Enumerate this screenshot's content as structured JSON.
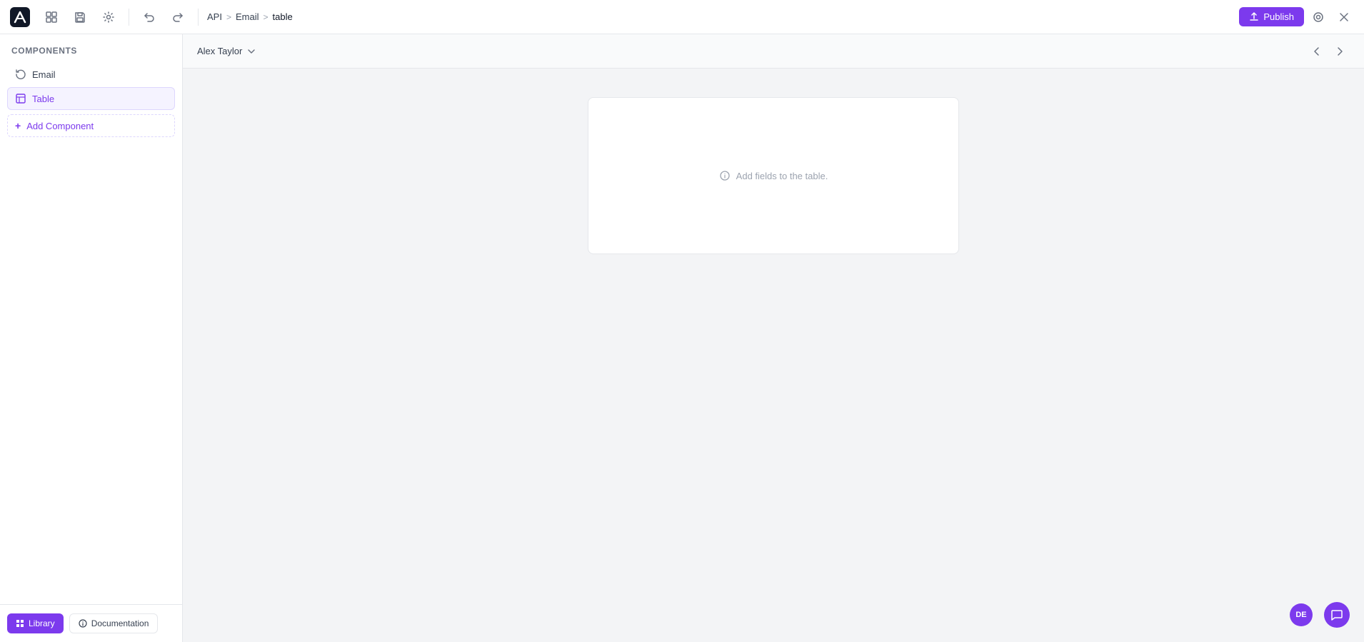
{
  "app": {
    "logo_text": "A"
  },
  "topbar": {
    "breadcrumb": {
      "api": "API",
      "sep1": ">",
      "email": "Email",
      "sep2": ">",
      "table": "table"
    },
    "undo_label": "Undo",
    "redo_label": "Redo",
    "settings_label": "Settings",
    "publish_label": "Publish",
    "preview_label": "Preview",
    "close_label": "Close"
  },
  "sidebar": {
    "title": "Components",
    "components": [
      {
        "id": "email",
        "label": "Email",
        "icon": "refresh-icon"
      },
      {
        "id": "table",
        "label": "Table",
        "icon": "table-icon",
        "selected": true
      }
    ],
    "add_component_label": "Add Component",
    "footer": {
      "library_label": "Library",
      "documentation_label": "Documentation"
    }
  },
  "canvas": {
    "user_name": "Alex Taylor",
    "table_empty_message": "Add fields to the table."
  },
  "bottom_right": {
    "avatar_initials": "DE",
    "chat_label": "Chat"
  }
}
